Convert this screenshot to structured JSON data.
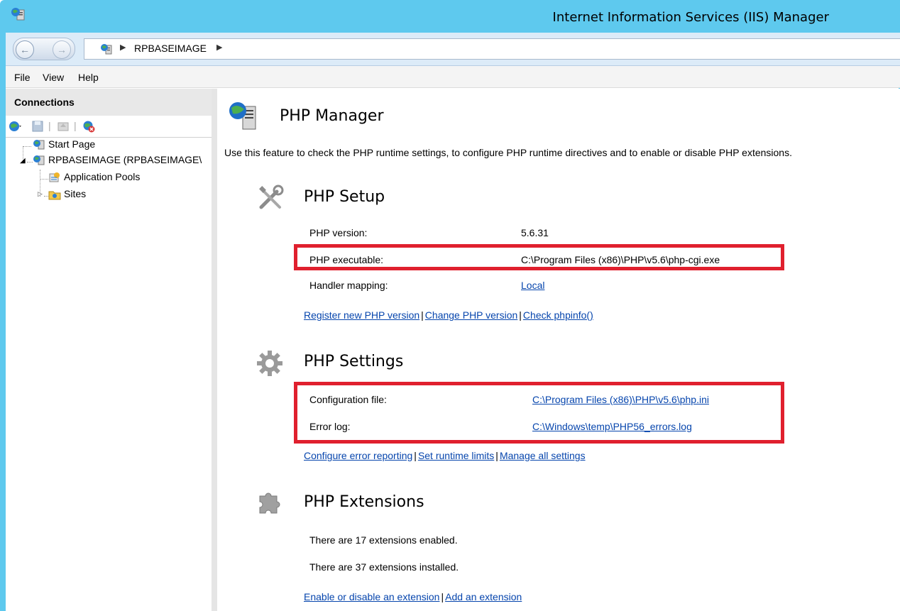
{
  "window": {
    "title": "Internet Information Services (IIS) Manager"
  },
  "address": {
    "crumb": "RPBASEIMAGE"
  },
  "menu": {
    "file": "File",
    "view": "View",
    "help": "Help"
  },
  "connections": {
    "header": "Connections",
    "tree": [
      {
        "label": "Start Page"
      },
      {
        "label": "RPBASEIMAGE (RPBASEIMAGE\\"
      },
      {
        "label": "Application Pools"
      },
      {
        "label": "Sites"
      }
    ]
  },
  "main": {
    "title": "PHP Manager",
    "description": "Use this feature to check the PHP runtime settings, to configure PHP runtime directives and to enable or disable PHP extensions.",
    "setup": {
      "title": "PHP Setup",
      "version_label": "PHP version:",
      "version_value": "5.6.31",
      "executable_label": "PHP executable:",
      "executable_value": "C:\\Program Files (x86)\\PHP\\v5.6\\php-cgi.exe",
      "handler_label": "Handler mapping:",
      "handler_value": "Local",
      "links": [
        "Register new PHP version",
        "Change PHP version",
        "Check phpinfo()"
      ]
    },
    "settings": {
      "title": "PHP Settings",
      "config_label": "Configuration file:",
      "config_value": "C:\\Program Files (x86)\\PHP\\v5.6\\php.ini",
      "errorlog_label": "Error log:",
      "errorlog_value": "C:\\Windows\\temp\\PHP56_errors.log",
      "links": [
        "Configure error reporting",
        "Set runtime limits",
        "Manage all settings"
      ]
    },
    "extensions": {
      "title": "PHP Extensions",
      "enabled_text": "There are 17 extensions enabled.",
      "installed_text": "There are 37 extensions installed.",
      "links": [
        "Enable or disable an extension",
        "Add an extension"
      ]
    }
  },
  "colors": {
    "titlebar": "#5ec9ee",
    "link": "#0645ad",
    "highlight": "#e0202e"
  }
}
